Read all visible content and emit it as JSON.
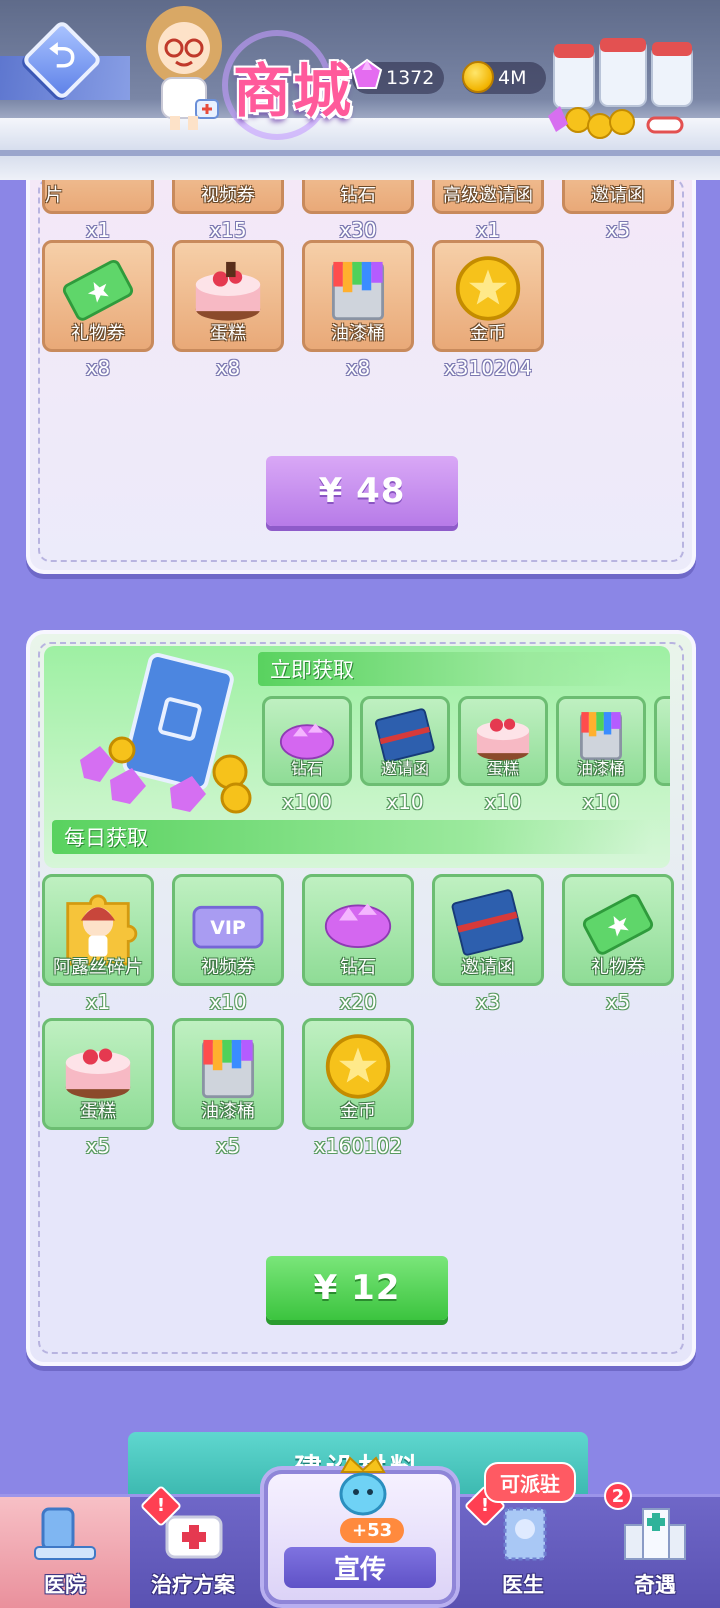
{
  "header": {
    "back_label": "⮌",
    "title": "商城",
    "gems": "1372",
    "coins": "4M"
  },
  "pack1": {
    "top_row": [
      {
        "name": "松鼠公主碎片",
        "qty": "x1"
      },
      {
        "name": "视频券",
        "qty": "x15"
      },
      {
        "name": "钻石",
        "qty": "x30"
      },
      {
        "name": "高级邀请函",
        "qty": "x1"
      },
      {
        "name": "邀请函",
        "qty": "x5"
      }
    ],
    "items": [
      {
        "name": "礼物券",
        "qty": "x8"
      },
      {
        "name": "蛋糕",
        "qty": "x8"
      },
      {
        "name": "油漆桶",
        "qty": "x8"
      },
      {
        "name": "金币",
        "qty": "x310204"
      }
    ],
    "price": "¥ 48"
  },
  "pack2": {
    "instant_label": "立即获取",
    "instant_items": [
      {
        "name": "钻石",
        "qty": "x100"
      },
      {
        "name": "邀请函",
        "qty": "x10"
      },
      {
        "name": "蛋糕",
        "qty": "x10"
      },
      {
        "name": "油漆桶",
        "qty": "x10"
      }
    ],
    "daily_label": "每日获取",
    "daily_items": [
      {
        "name": "阿露丝碎片",
        "qty": "x1"
      },
      {
        "name": "视频券",
        "qty": "x10"
      },
      {
        "name": "钻石",
        "qty": "x20"
      },
      {
        "name": "邀请函",
        "qty": "x3"
      },
      {
        "name": "礼物券",
        "qty": "x5"
      },
      {
        "name": "蛋糕",
        "qty": "x5"
      },
      {
        "name": "油漆桶",
        "qty": "x5"
      },
      {
        "name": "金币",
        "qty": "x160102"
      }
    ],
    "price": "¥ 12"
  },
  "build_tab": "建设材料",
  "nav": {
    "hospital": "医院",
    "treatment": "治疗方案",
    "promote": "宣传",
    "promote_badge": "+53",
    "doctor": "医生",
    "doctor_badge": "可派驻",
    "encounter": "奇遇",
    "encounter_count": "2"
  },
  "colors": {
    "background": "#8b86e6",
    "purple_button": "#b77be8",
    "green_button": "#3cc43f",
    "nav_bar": "#5a52b2"
  }
}
